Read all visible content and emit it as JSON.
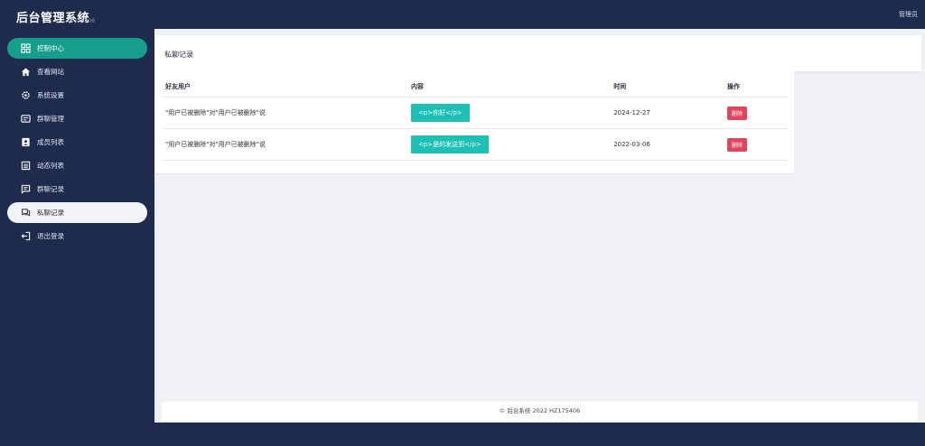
{
  "header": {
    "title": "后台管理系统",
    "version": "V175406",
    "user": "管理员"
  },
  "sidebar": {
    "items": [
      {
        "label": "控制中心",
        "icon": "dashboard-icon"
      },
      {
        "label": "查看网站",
        "icon": "home-icon"
      },
      {
        "label": "系统设置",
        "icon": "gear-icon"
      },
      {
        "label": "群聊管理",
        "icon": "chat-manage-icon"
      },
      {
        "label": "成员列表",
        "icon": "contacts-icon"
      },
      {
        "label": "动态列表",
        "icon": "list-icon"
      },
      {
        "label": "群聊记录",
        "icon": "message-icon"
      },
      {
        "label": "私聊记录",
        "icon": "private-chat-icon"
      },
      {
        "label": "退出登录",
        "icon": "logout-icon"
      }
    ]
  },
  "page": {
    "title": "私聊记录"
  },
  "table": {
    "columns": [
      "好友用户",
      "内容",
      "时间",
      "操作"
    ],
    "rows": [
      {
        "user": "\"用户已被删除\"对\"用户已被删除\"说",
        "content": "<p>你好</p>",
        "time": "2024-12-27",
        "action": "删除"
      },
      {
        "user": "\"用户已被删除\"对\"用户已被删除\"说",
        "content": "<p>是的发送到</p>",
        "time": "2022-03-06",
        "action": "删除"
      }
    ]
  },
  "footer": {
    "text": "© 后台系统 2022 HZ175406"
  },
  "colors": {
    "sidebar_bg": "#1f2b4d",
    "active_green": "#159e8b",
    "tag_teal": "#1cc0b5",
    "delete_red": "#e2445c"
  }
}
